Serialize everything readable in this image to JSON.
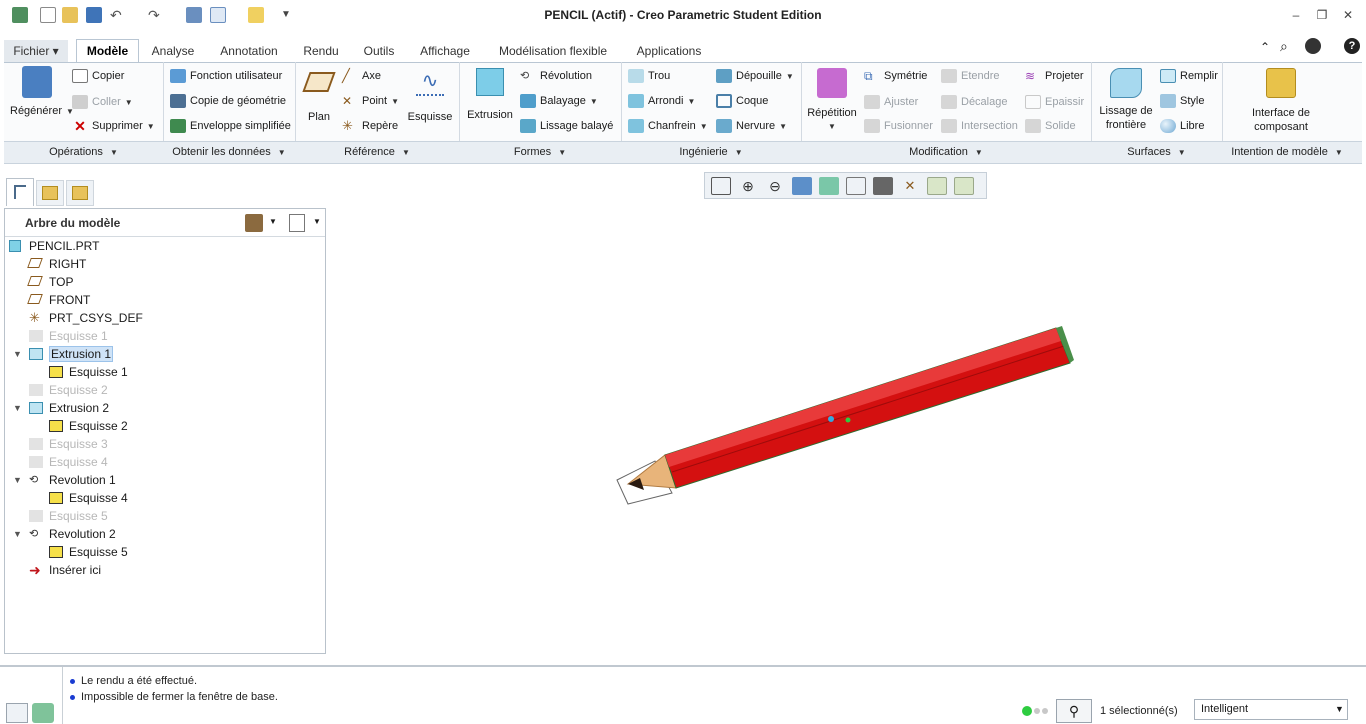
{
  "titlebar": {
    "title": "PENCIL (Actif) - Creo Parametric Student Edition",
    "quick_access": [
      "new-icon",
      "open-icon",
      "save-icon",
      "undo-icon",
      "redo-icon",
      "regenerate-icon",
      "windows-icon",
      "close-window-icon",
      "customize-icon"
    ]
  },
  "tabs": [
    "Fichier ▾",
    "Modèle",
    "Analyse",
    "Annotation",
    "Rendu",
    "Outils",
    "Affichage",
    "Modélisation flexible",
    "Applications"
  ],
  "ribbon": {
    "regenerer": "Régénérer",
    "copier": "Copier",
    "coller": "Coller",
    "supprimer": "Supprimer",
    "fonction_utilisateur": "Fonction utilisateur",
    "copie_geometrie": "Copie de géométrie",
    "enveloppe": "Enveloppe simplifiée",
    "plan": "Plan",
    "axe": "Axe",
    "point": "Point",
    "repere": "Repère",
    "esquisse": "Esquisse",
    "extrusion": "Extrusion",
    "revolution": "Révolution",
    "balayage": "Balayage",
    "lissage_balaye": "Lissage balayé",
    "trou": "Trou",
    "arrondi": "Arrondi",
    "chanfrein": "Chanfrein",
    "depouille": "Dépouille",
    "coque": "Coque",
    "nervure": "Nervure",
    "repetition": "Répétition",
    "symetrie": "Symétrie",
    "ajuster": "Ajuster",
    "fusionner": "Fusionner",
    "etendre": "Etendre",
    "decalage": "Décalage",
    "intersection": "Intersection",
    "projeter": "Projeter",
    "epaissir": "Epaissir",
    "solide": "Solide",
    "lissage_frontiere_1": "Lissage de",
    "lissage_frontiere_2": "frontière",
    "remplir": "Remplir",
    "style": "Style",
    "libre": "Libre",
    "interface_1": "Interface de",
    "interface_2": "composant"
  },
  "groups": [
    "Opérations",
    "Obtenir les données",
    "Référence",
    "Formes",
    "Ingénierie",
    "Modification",
    "Surfaces",
    "Intention de modèle"
  ],
  "tree": {
    "header": "Arbre du modèle",
    "items": [
      {
        "label": "PENCIL.PRT"
      },
      {
        "label": "RIGHT"
      },
      {
        "label": "TOP"
      },
      {
        "label": "FRONT"
      },
      {
        "label": "PRT_CSYS_DEF"
      },
      {
        "label": "Esquisse 1"
      },
      {
        "label": "Extrusion 1"
      },
      {
        "label": "Esquisse 1"
      },
      {
        "label": "Esquisse 2"
      },
      {
        "label": "Extrusion 2"
      },
      {
        "label": "Esquisse 2"
      },
      {
        "label": "Esquisse 3"
      },
      {
        "label": "Esquisse 4"
      },
      {
        "label": "Revolution 1"
      },
      {
        "label": "Esquisse 4"
      },
      {
        "label": "Esquisse 5"
      },
      {
        "label": "Revolution 2"
      },
      {
        "label": "Esquisse 5"
      },
      {
        "label": "Insérer ici"
      }
    ]
  },
  "status": {
    "messages": [
      "Le rendu a été effectué.",
      "Impossible de fermer la fenêtre de base."
    ],
    "selection_count": "1 sélectionné(s)",
    "filter": "Intelligent"
  },
  "colors": {
    "pencil_body": "#d41010",
    "pencil_wood": "#e8b47a",
    "accent": "#2a6fb5",
    "status_green": "#2ecc40"
  }
}
